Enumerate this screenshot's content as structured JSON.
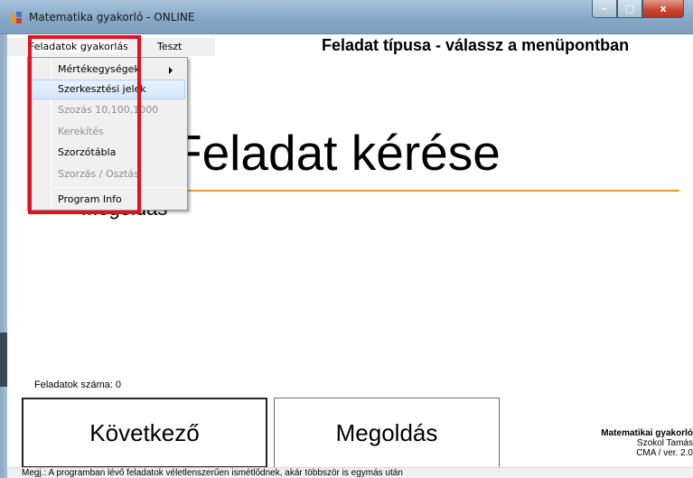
{
  "window": {
    "title": "Matematika gyakorló - ONLINE",
    "controls": {
      "minimize": "–",
      "maximize": "□",
      "close": "x"
    }
  },
  "menubar": {
    "items": [
      {
        "label": "Feladatok gyakorlás"
      },
      {
        "label": "Teszt"
      }
    ]
  },
  "dropdown": {
    "items": [
      {
        "label": "Mértékegységek",
        "state": "normal",
        "submenu": true
      },
      {
        "label": "Szerkesztési jelek",
        "state": "hover"
      },
      {
        "label": "Szozás 10,100,1000",
        "state": "disabled"
      },
      {
        "label": "Kerekítés",
        "state": "disabled"
      },
      {
        "label": "Szorzótábla",
        "state": "normal"
      },
      {
        "label": "Szorzás / Osztás",
        "state": "disabled"
      },
      {
        "label": "Program Info",
        "state": "normal"
      }
    ]
  },
  "main": {
    "task_type": "Feladat típusa - válassz a menüpontban",
    "big_title": "Feladat kérése",
    "solution_label": "Megoldás",
    "count_label": "Feladatok száma: 0"
  },
  "buttons": {
    "next": "Következő",
    "solve": "Megoldás"
  },
  "credits": {
    "line1": "Matematikai gyakorló",
    "line2": "Szokol Tamás",
    "line3": "CMA / ver. 2.0"
  },
  "status": {
    "text": "Megj.: A programban lévő feladatok véletlenszerűen ismétlődnek, akár többször is egymás után"
  },
  "colors": {
    "highlight_box": "#e0121f",
    "accent_line": "#f09a2a"
  }
}
